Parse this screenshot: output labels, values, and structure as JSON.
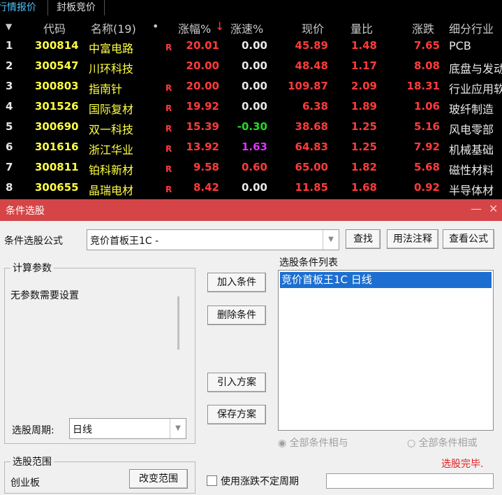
{
  "tabs": [
    "行情报价",
    "封板竞价"
  ],
  "table": {
    "headers": {
      "sort_arrow": "▼",
      "code": "代码",
      "name": "名称(19)",
      "dot": "•",
      "pct": "涨幅%",
      "pct_sort": "↓",
      "speed": "涨速%",
      "price": "现价",
      "vol_ratio": "量比",
      "change": "涨跌",
      "industry": "细分行业"
    },
    "rows": [
      {
        "idx": "1",
        "code": "300814",
        "name": "中富电路",
        "flag": "R",
        "pct": "20.01",
        "speed": "0.00",
        "price": "45.89",
        "vol": "1.48",
        "chg": "7.65",
        "ind": "PCB"
      },
      {
        "idx": "2",
        "code": "300547",
        "name": "川环科技",
        "flag": "",
        "pct": "20.00",
        "speed": "0.00",
        "price": "48.48",
        "vol": "1.17",
        "chg": "8.08",
        "ind": "底盘与发动"
      },
      {
        "idx": "3",
        "code": "300803",
        "name": "指南针",
        "flag": "R",
        "pct": "20.00",
        "speed": "0.00",
        "price": "109.87",
        "vol": "2.09",
        "chg": "18.31",
        "ind": "行业应用软"
      },
      {
        "idx": "4",
        "code": "301526",
        "name": "国际复材",
        "flag": "R",
        "pct": "19.92",
        "speed": "0.00",
        "price": "6.38",
        "vol": "1.89",
        "chg": "1.06",
        "ind": "玻纤制造"
      },
      {
        "idx": "5",
        "code": "300690",
        "name": "双一科技",
        "flag": "R",
        "pct": "15.39",
        "speed": "-0.30",
        "price": "38.68",
        "vol": "1.25",
        "chg": "5.16",
        "ind": "风电零部"
      },
      {
        "idx": "6",
        "code": "301616",
        "name": "浙江华业",
        "flag": "R",
        "pct": "13.92",
        "speed": "1.63",
        "price": "64.83",
        "vol": "1.25",
        "chg": "7.92",
        "ind": "机械基础"
      },
      {
        "idx": "7",
        "code": "300811",
        "name": "铂科新材",
        "flag": "R",
        "pct": "9.58",
        "speed": "0.60",
        "price": "65.00",
        "vol": "1.82",
        "chg": "5.68",
        "ind": "磁性材料"
      },
      {
        "idx": "8",
        "code": "300655",
        "name": "晶瑞电材",
        "flag": "R",
        "pct": "8.42",
        "speed": "0.00",
        "price": "11.85",
        "vol": "1.68",
        "chg": "0.92",
        "ind": "半导体材"
      }
    ],
    "speed_colors": [
      "white",
      "white",
      "white",
      "white",
      "green",
      "purple",
      "red",
      "white"
    ]
  },
  "dialog": {
    "title": "条件选股",
    "minimize": "—",
    "close": "✕",
    "formula_label": "条件选股公式",
    "formula_value": "竞价首板王1C  -",
    "find_button": "查找",
    "usage_button": "用法注释",
    "view_formula_button": "查看公式",
    "params_legend": "计算参数",
    "params_text": "无参数需要设置",
    "period_label": "选股周期:",
    "period_value": "日线",
    "add_button": "加入条件",
    "delete_button": "删除条件",
    "import_button": "引入方案",
    "save_button": "保存方案",
    "conditions_label": "选股条件列表",
    "conditions": [
      "竞价首板王1C  日线"
    ],
    "radio_and": "全部条件相与",
    "radio_or": "全部条件相或",
    "status_text": "选股完毕.",
    "scope_legend": "选股范围",
    "scope_value": "创业板",
    "change_scope_button": "改变范围",
    "use_variable_period": "使用涨跌不定周期"
  }
}
